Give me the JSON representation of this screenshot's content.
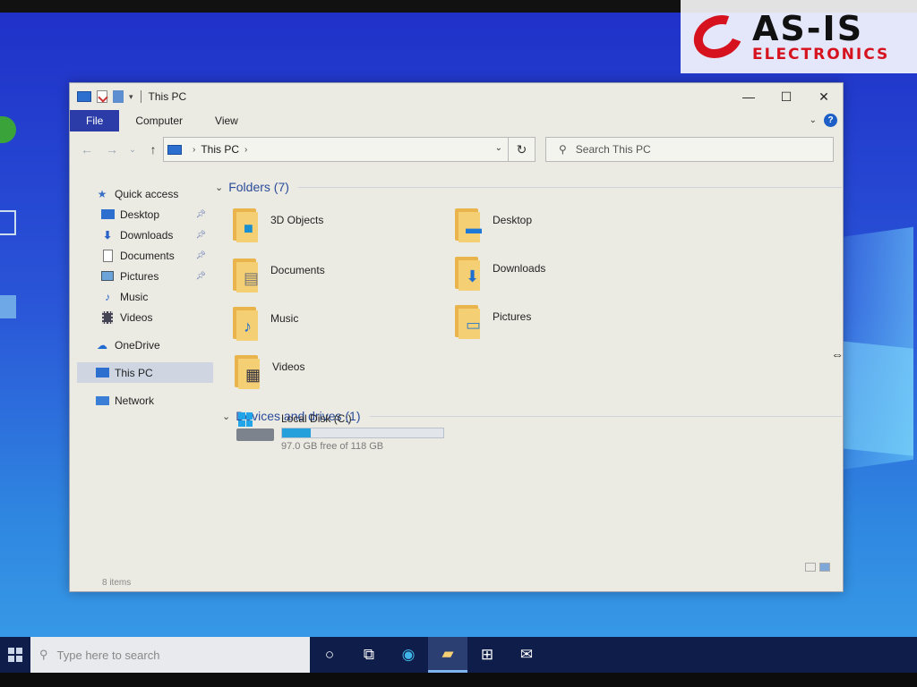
{
  "watermark": {
    "main": "AS-IS",
    "sub": "ELECTRONICS"
  },
  "window": {
    "title": "This PC",
    "controls": {
      "minimize": "—",
      "maximize": "☐",
      "close": "✕"
    }
  },
  "ribbon": {
    "tabs": [
      {
        "label": "File"
      },
      {
        "label": "Computer"
      },
      {
        "label": "View"
      }
    ],
    "help": "?"
  },
  "navigation": {
    "back": "←",
    "forward": "→",
    "recent": "⌄",
    "up": "↑",
    "address": {
      "crumb": "This PC",
      "separator": "›"
    },
    "refresh": "↻",
    "search_placeholder": "Search This PC"
  },
  "nav_pane": {
    "quick_access": "Quick access",
    "items": [
      {
        "label": "Desktop",
        "pinned": true
      },
      {
        "label": "Downloads",
        "pinned": true
      },
      {
        "label": "Documents",
        "pinned": true
      },
      {
        "label": "Pictures",
        "pinned": true
      },
      {
        "label": "Music",
        "pinned": false
      },
      {
        "label": "Videos",
        "pinned": false
      }
    ],
    "onedrive": "OneDrive",
    "this_pc": "This PC",
    "network": "Network"
  },
  "content": {
    "folders_header": "Folders (7)",
    "folders": [
      {
        "name": "3D Objects",
        "icon": "cube-icon"
      },
      {
        "name": "Desktop",
        "icon": "monitor-icon"
      },
      {
        "name": "Documents",
        "icon": "document-icon"
      },
      {
        "name": "Downloads",
        "icon": "download-arrow-icon"
      },
      {
        "name": "Music",
        "icon": "music-note-icon"
      },
      {
        "name": "Pictures",
        "icon": "picture-icon"
      },
      {
        "name": "Videos",
        "icon": "film-icon"
      }
    ],
    "drives_header": "Devices and drives (1)",
    "drives": [
      {
        "name": "Local Disk (C:)",
        "free_text": "97.0 GB free of 118 GB",
        "used_fraction": 0.178
      }
    ]
  },
  "status": {
    "items_count": "8 items"
  },
  "taskbar": {
    "search_placeholder": "Type here to search"
  },
  "colors": {
    "accent": "#2b3ca8",
    "drive_fill": "#26a0da",
    "folder": "#f5cf74"
  }
}
